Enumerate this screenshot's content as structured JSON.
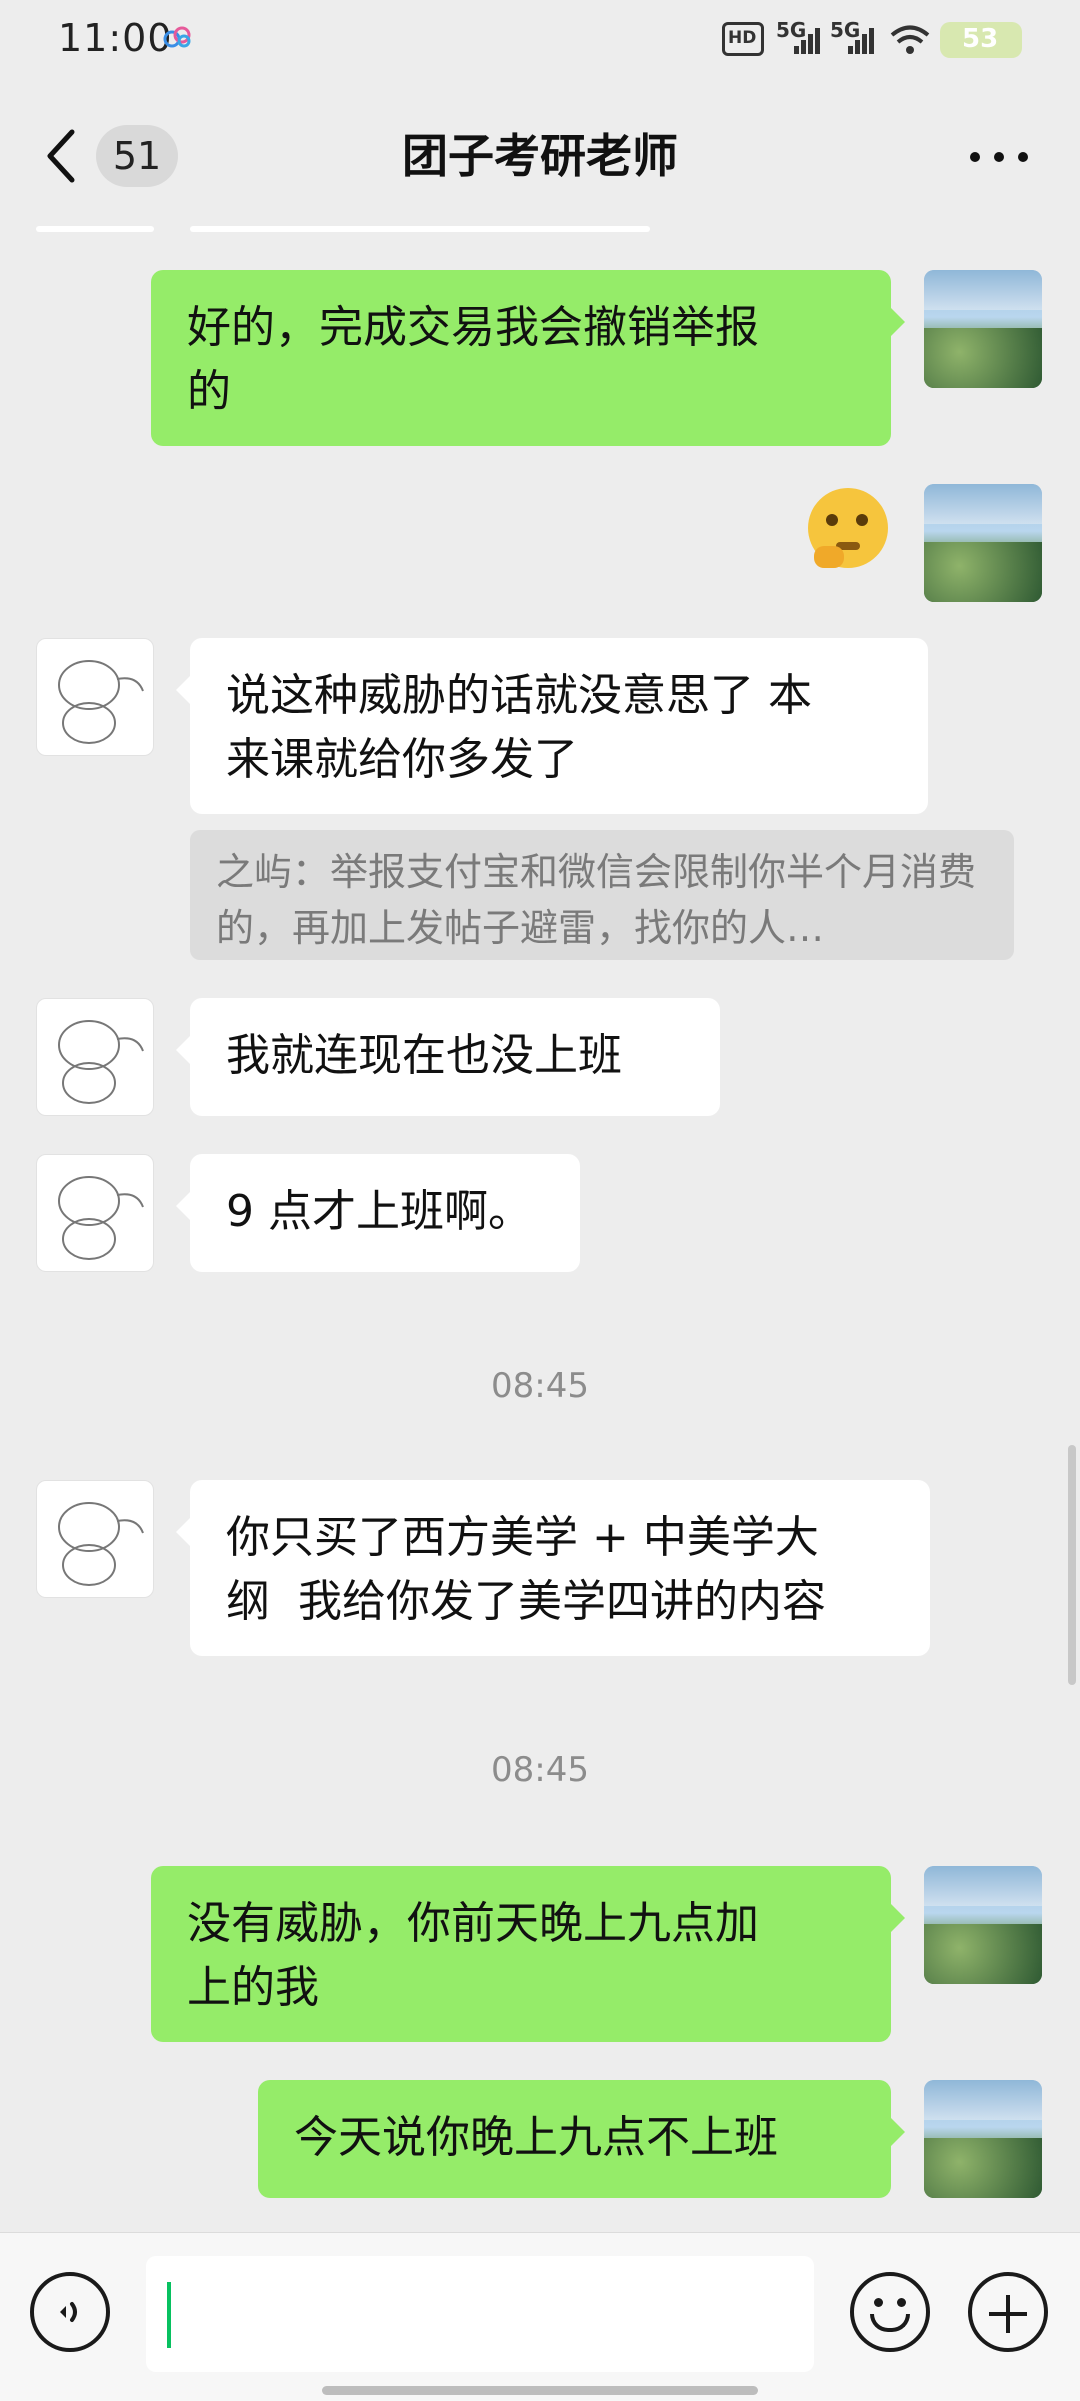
{
  "status_bar": {
    "time": "11:00",
    "hd_label": "HD",
    "signal1_label": "5G",
    "signal2_label": "5G",
    "battery_level": "53",
    "icons": [
      "cloud-icon",
      "hd-icon",
      "signal-5g-icon",
      "signal-5g-icon",
      "wifi-icon",
      "battery-icon"
    ]
  },
  "header": {
    "back_icon": "chevron-left-icon",
    "unread_count": "51",
    "title": "团子考研老师",
    "more_icon": "more-dots-icon"
  },
  "messages": [
    {
      "side": "out",
      "text": "好的，完成交易我会撤销举报\n的"
    },
    {
      "side": "out",
      "type": "sticker",
      "sticker": "thinking-face-emoji"
    },
    {
      "side": "in",
      "text": "说这种威胁的话就没意思了 本\n来课就给你多发了",
      "quote": "之屿：举报支付宝和微信会限制你半个月消费的，再加上发帖子避雷，找你的人…"
    },
    {
      "side": "in",
      "text": "我就连现在也没上班"
    },
    {
      "side": "in",
      "text": "9 点才上班啊。"
    },
    {
      "type": "timestamp",
      "text": "08:45"
    },
    {
      "side": "in",
      "text": "你只买了西方美学 + 中美学大\n纲  我给你发了美学四讲的内容"
    },
    {
      "type": "timestamp",
      "text": "08:45"
    },
    {
      "side": "out",
      "text": "没有威胁，你前天晚上九点加\n上的我"
    },
    {
      "side": "out",
      "text": "今天说你晚上九点不上班"
    }
  ],
  "input_bar": {
    "voice_icon": "voice-icon",
    "input_value": "",
    "emoji_icon": "emoji-icon",
    "plus_icon": "plus-icon"
  },
  "colors": {
    "background": "#ededed",
    "outgoing_bubble": "#95ec69",
    "incoming_bubble": "#ffffff",
    "quote_bg": "#dcdcdc",
    "caret": "#07c160"
  }
}
